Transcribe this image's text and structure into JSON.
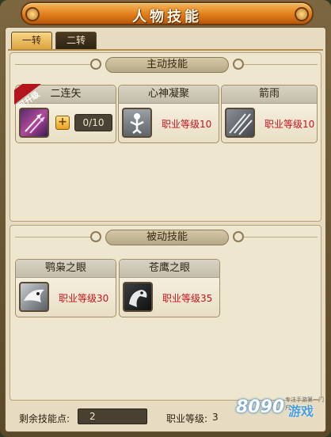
{
  "window": {
    "title": "人物技能"
  },
  "tabs": [
    {
      "label": "一转",
      "active": true
    },
    {
      "label": "二转",
      "active": false
    }
  ],
  "active_section": {
    "title": "主动技能",
    "skills": [
      {
        "name": "二连矢",
        "badge": "可升级",
        "level": "0/10",
        "icon": "double-arrow-icon"
      },
      {
        "name": "心神凝聚",
        "requirement": "职业等级10",
        "icon": "focus-figure-icon"
      },
      {
        "name": "箭雨",
        "requirement": "职业等级10",
        "icon": "arrow-rain-icon"
      }
    ]
  },
  "passive_section": {
    "title": "被动技能",
    "skills": [
      {
        "name": "鹗枭之眼",
        "requirement": "职业等级30",
        "icon": "owl-eye-icon"
      },
      {
        "name": "苍鹰之眼",
        "requirement": "职业等级35",
        "icon": "hawk-eye-icon"
      }
    ]
  },
  "footer": {
    "remaining_points_label": "剩余技能点:",
    "remaining_points_value": "2",
    "job_level_label": "职业等级:",
    "job_level_value": "3"
  },
  "watermark": {
    "number": "8090",
    "brand": "游戏",
    "small": "专注手游第一门户"
  },
  "colors": {
    "title_orange": "#e17f1a",
    "requirement_red": "#c8141c",
    "panel_bg": "#e7dcc1"
  }
}
